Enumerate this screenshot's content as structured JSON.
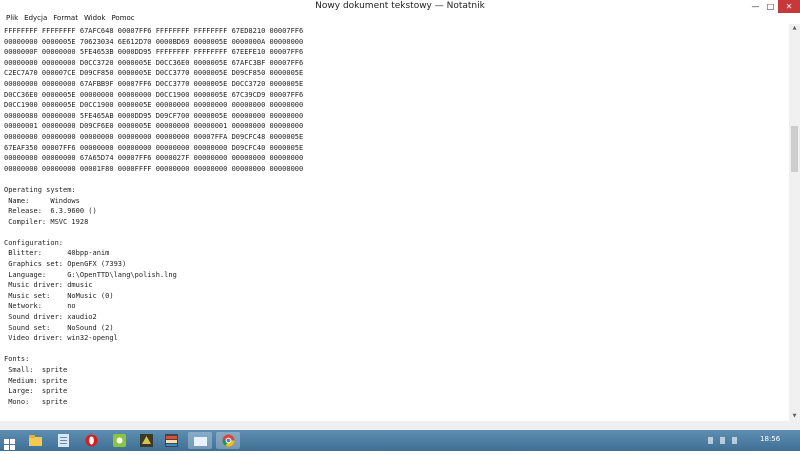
{
  "window": {
    "title": "Nowy dokument tekstowy — Notatnik",
    "minimize_glyph": "—",
    "maximize_glyph": "□",
    "close_glyph": "✕"
  },
  "menu": {
    "items": [
      "Plik",
      "Edycja",
      "Format",
      "Widok",
      "Pomoc"
    ]
  },
  "document": {
    "content": "FFFFFFFF FFFFFFFF 67AFC648 00007FF6 FFFFFFFF FFFFFFFF 67ED8210 00007FF6\n00000000 0000005E 70623034 6E612D70 0000BD69 0000005E 0000000A 00000000\n0000000F 00000000 5FE4653B 0000DD95 FFFFFFFF FFFFFFFF 67EEFE10 00007FF6\n00000000 00000000 D0CC3720 0000005E D0CC36E0 0000005E 67AFC3BF 00007FF6\nC2EC7A70 000007CE D09CF850 0000005E D0CC3770 0000005E D09CF850 0000005E\n00000000 00000000 67AFBB9F 00007FF6 D0CC3770 0000005E D0CC3720 0000005E\nD0CC36E0 0000005E 00000000 00000000 D0CC1900 0000005E 67C39CD9 00007FF6\nD0CC1900 0000005E D0CC1900 0000005E 00000000 00000000 00000000 00000000\n00000080 00000000 5FE465AB 0000DD95 D09CF700 0000005E 00000000 00000000\n00000001 00000000 D09CF6E0 0000005E 00000000 00000001 00000000 00000000\n00000000 00000000 00000000 00000000 00000000 00007FFA D09CFC48 0000005E\n67EAF350 00007FF6 00000000 00000000 00000000 00000000 D09CFC40 0000005E\n00000000 00000000 67A65D74 00007FF6 0000027F 00000000 00000000 00000000\n00000000 00000000 00001F80 0000FFFF 00000000 00000000 00000000 00000000\n\nOperating system:\n Name:     Windows\n Release:  6.3.9600 ()\n Compiler: MSVC 1928\n\nConfiguration:\n Blitter:      40bpp-anim\n Graphics set: OpenGFX (7393)\n Language:     G:\\OpenTTD\\lang\\polish.lng\n Music driver: dmusic\n Music set:    NoMusic (0)\n Network:      no\n Sound driver: xaudio2\n Sound set:    NoSound (2)\n Video driver: win32-opengl\n\nFonts:\n Small:  sprite\n Medium: sprite\n Large:  sprite\n Mono:   sprite"
  },
  "scrollbar": {
    "up_glyph": "▲",
    "down_glyph": "▼"
  },
  "taskbar": {
    "apps": [
      {
        "icon": "windows-start-icon"
      },
      {
        "icon": "file-explorer-icon"
      },
      {
        "icon": "notepad-icon"
      },
      {
        "icon": "opera-browser-icon"
      },
      {
        "icon": "settings-app-icon"
      },
      {
        "icon": "game-icon"
      },
      {
        "icon": "openttd-icon"
      },
      {
        "icon": "window-icon"
      },
      {
        "icon": "chrome-browser-icon"
      }
    ],
    "clock": "18:56"
  },
  "colors": {
    "close_button": "#c7383a",
    "taskbar": "#4f7fa4",
    "opera_red": "#d91d1d"
  }
}
